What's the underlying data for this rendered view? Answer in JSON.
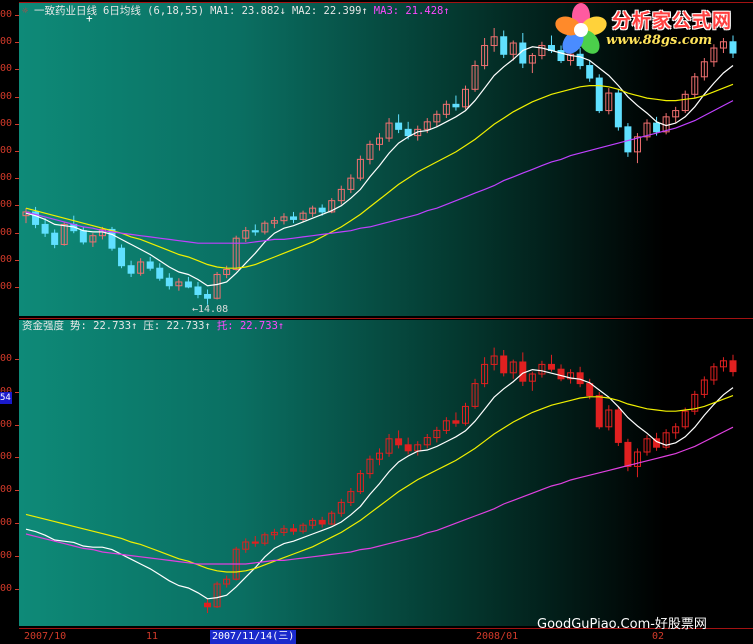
{
  "main": {
    "icon": "candle-icon",
    "title": "一致药业日线",
    "ma_label": "6日均线 (6,18,55)",
    "ma1": "MA1: 23.882↓",
    "ma2": "MA2: 22.399↑",
    "ma3": "MA3: 21.428↑",
    "low_label": "←14.08",
    "cursor_glyph": "+"
  },
  "sub": {
    "title": "资金强度",
    "shi": "势: 22.733↑",
    "ya": "压: 22.733↑",
    "tuo": "托: 22.733↑",
    "axis_badge": "54"
  },
  "axis": {
    "main_ticks": [
      "00",
      "00",
      "00",
      "00",
      "00",
      "00",
      "00",
      "00",
      "00",
      "00",
      "00"
    ],
    "sub_ticks": [
      "00",
      "00",
      "00",
      "00",
      "00",
      "00",
      "00",
      "00"
    ]
  },
  "dates": {
    "d1": "2007/10",
    "d2": "11",
    "d3": "2007/11/14(三)",
    "d4": "2008/01",
    "d5": "02"
  },
  "logo": {
    "title": "分析家公式网",
    "url": "www.88gs.com"
  },
  "watermark": "GoodGuPiao.Com-好股票网",
  "colors": {
    "up": "#f07070",
    "down": "#60e0ff",
    "ma1": "#ffffff",
    "ma2": "#f0f000",
    "ma3": "#c040ff",
    "grid": "#a31212",
    "sub_up": "#e02020"
  },
  "chart_data": {
    "type": "candlestick",
    "title": "一致药业日线",
    "low_annotation": 14.08,
    "candles": [
      [
        21.2,
        21.8,
        20.6,
        21.5
      ],
      [
        21.5,
        21.9,
        20.2,
        20.5
      ],
      [
        20.5,
        21.0,
        19.5,
        19.8
      ],
      [
        19.8,
        20.1,
        18.6,
        18.9
      ],
      [
        18.9,
        20.7,
        18.8,
        20.5
      ],
      [
        20.5,
        21.2,
        19.8,
        20.0
      ],
      [
        20.0,
        20.3,
        18.9,
        19.1
      ],
      [
        19.1,
        19.8,
        18.7,
        19.6
      ],
      [
        19.6,
        20.3,
        19.3,
        20.1
      ],
      [
        20.1,
        20.3,
        18.4,
        18.6
      ],
      [
        18.6,
        18.9,
        17.0,
        17.2
      ],
      [
        17.2,
        17.6,
        16.3,
        16.6
      ],
      [
        16.6,
        17.8,
        16.4,
        17.5
      ],
      [
        17.5,
        17.9,
        16.8,
        17.0
      ],
      [
        17.0,
        17.4,
        16.0,
        16.2
      ],
      [
        16.2,
        16.6,
        15.3,
        15.6
      ],
      [
        15.6,
        16.2,
        15.2,
        15.9
      ],
      [
        15.9,
        16.3,
        15.4,
        15.5
      ],
      [
        15.5,
        15.9,
        14.6,
        14.9
      ],
      [
        14.9,
        15.3,
        14.08,
        14.6
      ],
      [
        14.6,
        16.7,
        14.5,
        16.5
      ],
      [
        16.5,
        17.2,
        16.2,
        16.9
      ],
      [
        16.9,
        19.6,
        16.8,
        19.4
      ],
      [
        19.4,
        20.3,
        19.1,
        20.0
      ],
      [
        20.0,
        20.5,
        19.6,
        19.9
      ],
      [
        19.9,
        20.8,
        19.7,
        20.6
      ],
      [
        20.6,
        21.1,
        20.2,
        20.8
      ],
      [
        20.8,
        21.4,
        20.5,
        21.1
      ],
      [
        21.1,
        21.5,
        20.6,
        20.9
      ],
      [
        20.9,
        21.6,
        20.7,
        21.4
      ],
      [
        21.4,
        22.0,
        21.1,
        21.8
      ],
      [
        21.8,
        22.1,
        21.2,
        21.5
      ],
      [
        21.5,
        22.6,
        21.4,
        22.4
      ],
      [
        22.4,
        23.6,
        22.1,
        23.3
      ],
      [
        23.3,
        24.5,
        23.0,
        24.2
      ],
      [
        24.2,
        26.0,
        24.0,
        25.7
      ],
      [
        25.7,
        27.2,
        25.3,
        26.9
      ],
      [
        26.9,
        27.8,
        26.4,
        27.4
      ],
      [
        27.4,
        29.0,
        27.1,
        28.6
      ],
      [
        28.6,
        29.3,
        27.8,
        28.1
      ],
      [
        28.1,
        28.7,
        27.3,
        27.6
      ],
      [
        27.6,
        28.4,
        27.2,
        28.1
      ],
      [
        28.1,
        29.0,
        27.8,
        28.7
      ],
      [
        28.7,
        29.6,
        28.3,
        29.3
      ],
      [
        29.3,
        30.4,
        29.0,
        30.1
      ],
      [
        30.1,
        30.8,
        29.6,
        29.9
      ],
      [
        29.9,
        31.6,
        29.7,
        31.3
      ],
      [
        31.3,
        33.6,
        31.1,
        33.2
      ],
      [
        33.2,
        35.4,
        32.9,
        34.8
      ],
      [
        34.8,
        36.2,
        34.3,
        35.5
      ],
      [
        35.5,
        36.0,
        33.8,
        34.1
      ],
      [
        34.1,
        35.2,
        33.6,
        35.0
      ],
      [
        35.0,
        35.8,
        33.0,
        33.4
      ],
      [
        33.4,
        34.2,
        32.6,
        34.0
      ],
      [
        34.0,
        35.1,
        33.7,
        34.8
      ],
      [
        34.8,
        35.6,
        34.2,
        34.4
      ],
      [
        34.4,
        34.8,
        33.4,
        33.6
      ],
      [
        33.6,
        34.4,
        33.2,
        34.1
      ],
      [
        34.1,
        34.6,
        32.9,
        33.2
      ],
      [
        33.2,
        33.6,
        31.9,
        32.2
      ],
      [
        32.2,
        32.5,
        29.4,
        29.6
      ],
      [
        29.6,
        31.4,
        29.3,
        31.0
      ],
      [
        31.0,
        31.3,
        28.0,
        28.3
      ],
      [
        28.3,
        28.6,
        25.9,
        26.3
      ],
      [
        26.3,
        27.8,
        25.4,
        27.5
      ],
      [
        27.5,
        28.9,
        27.2,
        28.6
      ],
      [
        28.6,
        29.1,
        27.6,
        27.9
      ],
      [
        27.9,
        29.4,
        27.7,
        29.1
      ],
      [
        29.1,
        29.9,
        28.6,
        29.6
      ],
      [
        29.6,
        31.2,
        29.4,
        30.9
      ],
      [
        30.9,
        32.6,
        30.6,
        32.3
      ],
      [
        32.3,
        33.8,
        32.0,
        33.5
      ],
      [
        33.5,
        34.9,
        33.1,
        34.6
      ],
      [
        34.6,
        35.4,
        34.2,
        35.1
      ],
      [
        35.1,
        35.6,
        33.8,
        34.2
      ]
    ],
    "ma1": [
      21.4,
      21.2,
      20.9,
      20.5,
      20.4,
      20.3,
      20.0,
      19.9,
      19.9,
      19.7,
      19.3,
      18.9,
      18.5,
      18.1,
      17.6,
      17.1,
      16.7,
      16.5,
      16.1,
      15.6,
      15.7,
      15.9,
      16.6,
      17.4,
      18.2,
      19.1,
      19.8,
      20.2,
      20.4,
      20.7,
      21.0,
      21.3,
      21.6,
      22.0,
      22.6,
      23.3,
      24.3,
      25.2,
      26.2,
      27.0,
      27.5,
      27.9,
      28.0,
      28.3,
      28.7,
      29.1,
      29.6,
      30.4,
      31.4,
      32.4,
      33.1,
      33.7,
      34.4,
      34.7,
      34.6,
      34.4,
      34.2,
      34.0,
      33.9,
      33.6,
      33.0,
      32.4,
      31.6,
      30.7,
      30.0,
      29.4,
      28.7,
      28.4,
      28.6,
      29.1,
      29.9,
      30.9,
      31.8,
      32.6,
      33.2
    ],
    "ma2": [
      21.8,
      21.6,
      21.4,
      21.2,
      21.0,
      20.8,
      20.6,
      20.4,
      20.2,
      20.0,
      19.8,
      19.5,
      19.3,
      19.0,
      18.7,
      18.4,
      18.1,
      17.9,
      17.6,
      17.3,
      17.1,
      17.0,
      17.0,
      17.1,
      17.3,
      17.6,
      17.9,
      18.2,
      18.5,
      18.8,
      19.1,
      19.5,
      19.9,
      20.3,
      20.8,
      21.3,
      21.9,
      22.5,
      23.1,
      23.7,
      24.2,
      24.7,
      25.1,
      25.5,
      25.9,
      26.3,
      26.8,
      27.3,
      27.9,
      28.5,
      29.0,
      29.5,
      29.9,
      30.3,
      30.6,
      30.9,
      31.1,
      31.3,
      31.5,
      31.6,
      31.6,
      31.5,
      31.3,
      31.0,
      30.8,
      30.6,
      30.5,
      30.4,
      30.4,
      30.5,
      30.6,
      30.8,
      31.1,
      31.4,
      31.7
    ],
    "ma3": [
      21.5,
      21.3,
      21.1,
      20.9,
      20.7,
      20.5,
      20.3,
      20.2,
      20.0,
      19.9,
      19.8,
      19.7,
      19.6,
      19.5,
      19.4,
      19.3,
      19.2,
      19.1,
      19.0,
      19.0,
      19.0,
      19.0,
      19.0,
      19.0,
      19.1,
      19.2,
      19.3,
      19.3,
      19.4,
      19.5,
      19.6,
      19.7,
      19.8,
      19.9,
      20.0,
      20.2,
      20.3,
      20.5,
      20.7,
      20.9,
      21.1,
      21.3,
      21.6,
      21.8,
      22.1,
      22.4,
      22.7,
      23.0,
      23.3,
      23.6,
      24.0,
      24.3,
      24.6,
      24.9,
      25.2,
      25.5,
      25.7,
      26.0,
      26.2,
      26.4,
      26.6,
      26.8,
      27.0,
      27.2,
      27.4,
      27.6,
      27.8,
      28.0,
      28.2,
      28.5,
      28.8,
      29.2,
      29.6,
      30.0,
      30.4
    ]
  }
}
